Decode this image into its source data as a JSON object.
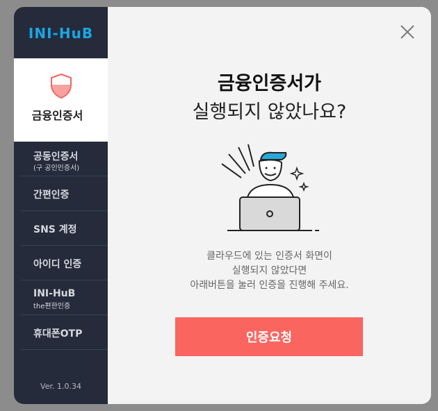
{
  "logo": {
    "text": "INI-HuB"
  },
  "sidebar": {
    "active": {
      "label": "금융인증서",
      "icon": "shield-icon"
    },
    "items": [
      {
        "label": "공동인증서",
        "sub": "(구 공인인증서)"
      },
      {
        "label": "간편인증",
        "sub": ""
      },
      {
        "label": "SNS 계정",
        "sub": ""
      },
      {
        "label": "아이디 인증",
        "sub": ""
      },
      {
        "label": "INI-HuB",
        "sub": "the편한인증"
      },
      {
        "label": "휴대폰OTP",
        "sub": ""
      }
    ],
    "version": "Ver. 1.0.34"
  },
  "main": {
    "title_line1": "금융인증서가",
    "title_line2": "실행되지 않았나요?",
    "description": [
      "클라우드에 있는 인증서 화면이",
      "실행되지 않았다면",
      "아래버튼을 눌러 인증을 진행해 주세요."
    ],
    "button_label": "인증요청",
    "close_icon": "close-icon"
  },
  "colors": {
    "sidebar_bg": "#252b3a",
    "accent_button": "#fb6560",
    "logo": "#1aa6e4",
    "illustration_accent": "#29a8d8"
  }
}
